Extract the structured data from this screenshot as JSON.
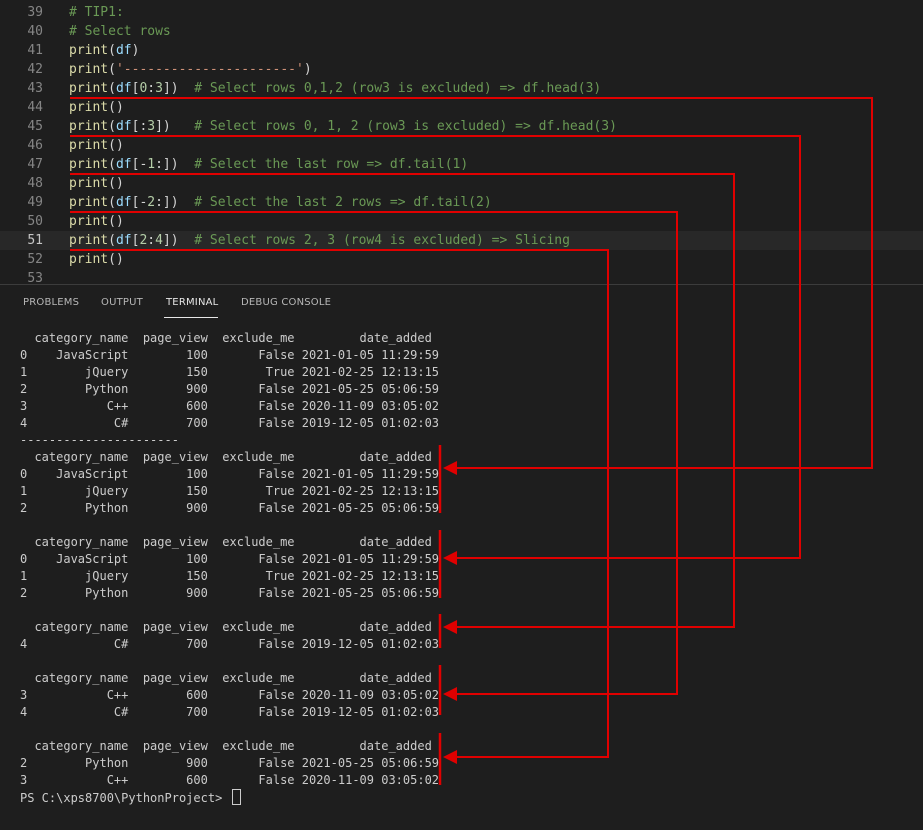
{
  "editor": {
    "lines": [
      {
        "num": "39",
        "tokens": [
          {
            "t": "# TIP1:",
            "c": "cm"
          }
        ]
      },
      {
        "num": "40",
        "tokens": [
          {
            "t": "# Select rows",
            "c": "cm"
          }
        ]
      },
      {
        "num": "41",
        "tokens": [
          {
            "t": "print",
            "c": "fn"
          },
          {
            "t": "(",
            "c": "pn"
          },
          {
            "t": "df",
            "c": "vr"
          },
          {
            "t": ")",
            "c": "pn"
          }
        ]
      },
      {
        "num": "42",
        "tokens": [
          {
            "t": "print",
            "c": "fn"
          },
          {
            "t": "(",
            "c": "pn"
          },
          {
            "t": "'----------------------'",
            "c": "st"
          },
          {
            "t": ")",
            "c": "pn"
          }
        ]
      },
      {
        "num": "43",
        "tokens": [
          {
            "t": "print",
            "c": "fn"
          },
          {
            "t": "(",
            "c": "pn"
          },
          {
            "t": "df",
            "c": "vr"
          },
          {
            "t": "[",
            "c": "pn"
          },
          {
            "t": "0",
            "c": "nm"
          },
          {
            "t": ":",
            "c": "pn"
          },
          {
            "t": "3",
            "c": "nm"
          },
          {
            "t": "])  ",
            "c": "pn"
          },
          {
            "t": "# Select rows 0,1,2 (row3 is excluded) => df.head(3)",
            "c": "cm"
          }
        ]
      },
      {
        "num": "44",
        "tokens": [
          {
            "t": "print",
            "c": "fn"
          },
          {
            "t": "()",
            "c": "pn"
          }
        ]
      },
      {
        "num": "45",
        "tokens": [
          {
            "t": "print",
            "c": "fn"
          },
          {
            "t": "(",
            "c": "pn"
          },
          {
            "t": "df",
            "c": "vr"
          },
          {
            "t": "[:",
            "c": "pn"
          },
          {
            "t": "3",
            "c": "nm"
          },
          {
            "t": "])   ",
            "c": "pn"
          },
          {
            "t": "# Select rows 0, 1, 2 (row3 is excluded) => df.head(3)",
            "c": "cm"
          }
        ]
      },
      {
        "num": "46",
        "tokens": [
          {
            "t": "print",
            "c": "fn"
          },
          {
            "t": "()",
            "c": "pn"
          }
        ]
      },
      {
        "num": "47",
        "tokens": [
          {
            "t": "print",
            "c": "fn"
          },
          {
            "t": "(",
            "c": "pn"
          },
          {
            "t": "df",
            "c": "vr"
          },
          {
            "t": "[-",
            "c": "pn"
          },
          {
            "t": "1",
            "c": "nm"
          },
          {
            "t": ":])  ",
            "c": "pn"
          },
          {
            "t": "# Select the last row => df.tail(1)",
            "c": "cm"
          }
        ]
      },
      {
        "num": "48",
        "tokens": [
          {
            "t": "print",
            "c": "fn"
          },
          {
            "t": "()",
            "c": "pn"
          }
        ]
      },
      {
        "num": "49",
        "tokens": [
          {
            "t": "print",
            "c": "fn"
          },
          {
            "t": "(",
            "c": "pn"
          },
          {
            "t": "df",
            "c": "vr"
          },
          {
            "t": "[-",
            "c": "pn"
          },
          {
            "t": "2",
            "c": "nm"
          },
          {
            "t": ":])  ",
            "c": "pn"
          },
          {
            "t": "# Select the last 2 rows => df.tail(2)",
            "c": "cm"
          }
        ]
      },
      {
        "num": "50",
        "tokens": [
          {
            "t": "print",
            "c": "fn"
          },
          {
            "t": "()",
            "c": "pn"
          }
        ]
      },
      {
        "num": "51",
        "tokens": [
          {
            "t": "print",
            "c": "fn"
          },
          {
            "t": "(",
            "c": "pn"
          },
          {
            "t": "df",
            "c": "vr"
          },
          {
            "t": "[",
            "c": "pn"
          },
          {
            "t": "2",
            "c": "nm"
          },
          {
            "t": ":",
            "c": "pn"
          },
          {
            "t": "4",
            "c": "nm"
          },
          {
            "t": "])  ",
            "c": "pn"
          },
          {
            "t": "# Select rows 2, 3 (row4 is excluded) => Slicing",
            "c": "cm"
          }
        ]
      },
      {
        "num": "52",
        "tokens": [
          {
            "t": "print",
            "c": "fn"
          },
          {
            "t": "()",
            "c": "pn"
          }
        ]
      },
      {
        "num": "53",
        "tokens": []
      }
    ]
  },
  "panel": {
    "tabs": [
      {
        "label": "PROBLEMS",
        "active": false
      },
      {
        "label": "OUTPUT",
        "active": false
      },
      {
        "label": "TERMINAL",
        "active": true
      },
      {
        "label": "DEBUG CONSOLE",
        "active": false
      }
    ]
  },
  "terminal": {
    "lines": [
      "  category_name  page_view  exclude_me         date_added",
      "0    JavaScript        100       False 2021-01-05 11:29:59",
      "1        jQuery        150        True 2021-02-25 12:13:15",
      "2        Python        900       False 2021-05-25 05:06:59",
      "3           C++        600       False 2020-11-09 03:05:02",
      "4            C#        700       False 2019-12-05 01:02:03",
      "----------------------",
      "  category_name  page_view  exclude_me         date_added",
      "0    JavaScript        100       False 2021-01-05 11:29:59",
      "1        jQuery        150        True 2021-02-25 12:13:15",
      "2        Python        900       False 2021-05-25 05:06:59",
      "",
      "  category_name  page_view  exclude_me         date_added",
      "0    JavaScript        100       False 2021-01-05 11:29:59",
      "1        jQuery        150        True 2021-02-25 12:13:15",
      "2        Python        900       False 2021-05-25 05:06:59",
      "",
      "  category_name  page_view  exclude_me         date_added",
      "4            C#        700       False 2019-12-05 01:02:03",
      "",
      "  category_name  page_view  exclude_me         date_added",
      "3           C++        600       False 2020-11-09 03:05:02",
      "4            C#        700       False 2019-12-05 01:02:03",
      "",
      "  category_name  page_view  exclude_me         date_added",
      "2        Python        900       False 2021-05-25 05:06:59",
      "3           C++        600       False 2020-11-09 03:05:02"
    ],
    "prompt": "PS C:\\xps8700\\PythonProject> "
  },
  "colors": {
    "annotation": "#e00000",
    "background": "#1e1e1e",
    "comment": "#6a9955",
    "function": "#dcdcaa",
    "variable": "#9cdcfe",
    "number": "#b5cea8",
    "string": "#ce9178"
  }
}
